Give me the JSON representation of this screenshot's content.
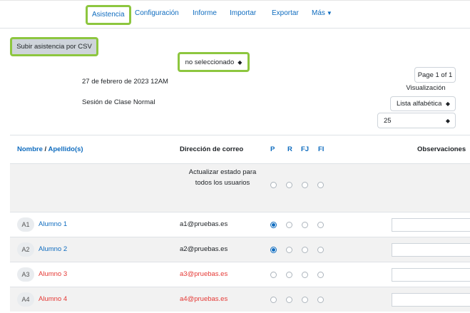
{
  "nav": {
    "tabs": [
      {
        "label": "Asistencia",
        "active": true
      },
      {
        "label": "Configuración"
      },
      {
        "label": "Informe"
      },
      {
        "label": "Importar"
      },
      {
        "label": "Exportar"
      },
      {
        "label": "Más"
      }
    ]
  },
  "upload_button": "Subir asistencia por CSV",
  "session": {
    "date": "27 de febrero de 2023 12AM",
    "type": "Sesión de Clase Normal"
  },
  "pager": "Page 1 of 1",
  "view": {
    "label": "Visualización",
    "sort_value": "Lista alfabética",
    "per_page_value": "25"
  },
  "table": {
    "headers": {
      "name_first": "Nombre",
      "separator": " / ",
      "name_last": "Apellido(s)",
      "email": "Dirección de correo",
      "p": "P",
      "r": "R",
      "fj": "FJ",
      "fi": "FI",
      "notes": "Observaciones"
    },
    "bulk": {
      "text": "Actualizar estado para todos los usuarios",
      "select_value": "no seleccionado"
    },
    "rows": [
      {
        "initials": "A1",
        "name": "Alumno 1",
        "email": "a1@pruebas.es",
        "status": "P",
        "highlight": false
      },
      {
        "initials": "A2",
        "name": "Alumno 2",
        "email": "a2@pruebas.es",
        "status": "P",
        "highlight": false
      },
      {
        "initials": "A3",
        "name": "Alumno 3",
        "email": "a3@pruebas.es",
        "status": "",
        "highlight": true
      },
      {
        "initials": "A4",
        "name": "Alumno 4",
        "email": "a4@pruebas.es",
        "status": "",
        "highlight": true
      }
    ]
  },
  "colors": {
    "accent": "#0f6cbf",
    "highlight_box": "#8dc63f",
    "warning_text": "#e53935",
    "row_alt": "#f2f2f2"
  }
}
